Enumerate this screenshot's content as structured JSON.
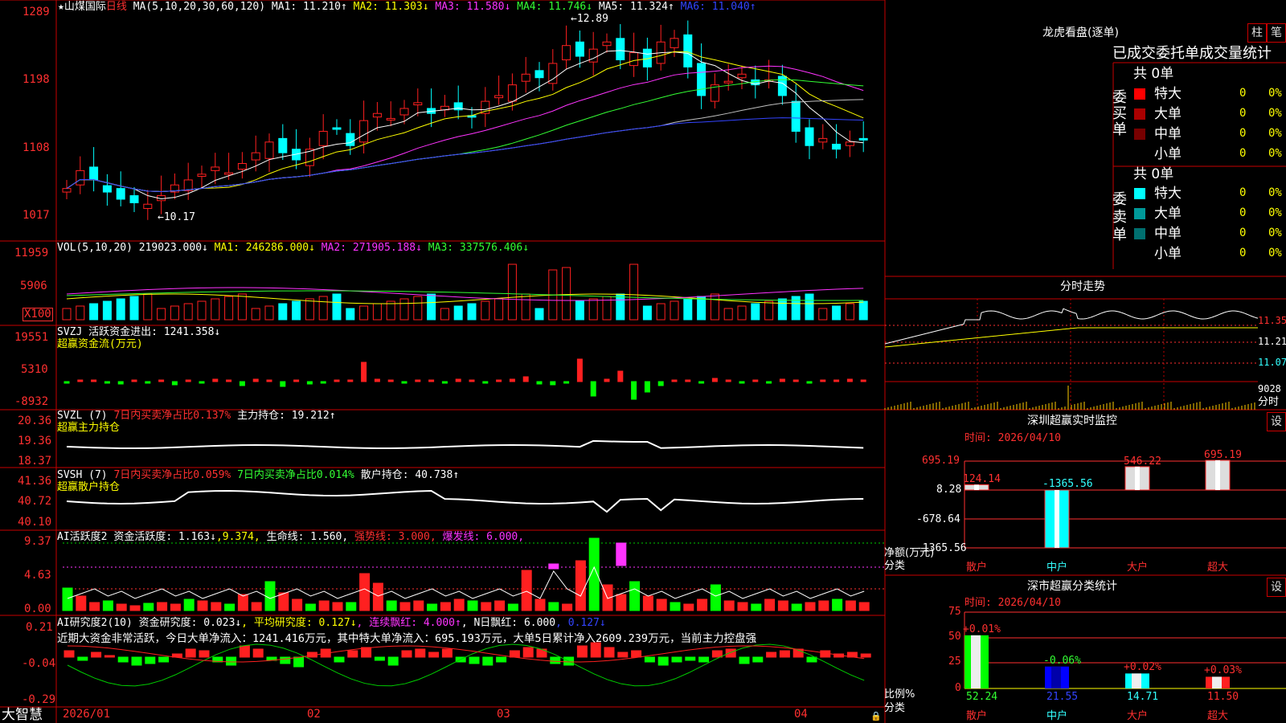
{
  "stock": {
    "name": "山煤国际",
    "period": "日线",
    "ma_header": "MA(5,10,20,30,60,120)",
    "ma1": "MA1: 11.210↑",
    "ma2": "MA2: 11.303↓",
    "ma3": "MA3: 11.580↓",
    "ma4": "MA4: 11.746↓",
    "ma5": "MA5: 11.324↑",
    "ma6": "MA6: 11.040↑",
    "high_label": "12.89",
    "low_label": "10.17",
    "y_ticks": [
      "1289",
      "1198",
      "1108",
      "1017"
    ]
  },
  "vol": {
    "header": "VOL(5,10,20)",
    "value": "219023.000↓",
    "ma1": "MA1: 246286.000↓",
    "ma2": "MA2: 271905.188↓",
    "ma3": "MA3: 337576.406↓",
    "y_ticks": [
      "11959",
      "5906"
    ],
    "unit": "X100"
  },
  "svzj": {
    "header": "SVZJ  活跃资金进出: 1241.358↓",
    "subtitle": "超赢资金流(万元)",
    "y_ticks": [
      "19551",
      "5310",
      "-8932"
    ]
  },
  "svzl": {
    "header": "SVZL (7)",
    "ratio": "7日内买卖净占比0.137%",
    "hold": "主力持仓: 19.212↑",
    "subtitle": "超赢主力持仓",
    "y_ticks": [
      "20.36",
      "19.36",
      "18.37"
    ]
  },
  "svsh": {
    "header": "SVSH (7)",
    "ratio1": "7日内买卖净占比0.059%",
    "ratio2": "7日内买卖净占比0.014%",
    "hold": "散户持仓: 40.738↑",
    "subtitle": "超赢散户持仓",
    "y_ticks": [
      "41.36",
      "40.72",
      "40.10"
    ]
  },
  "ai_active": {
    "header": "AI活跃度2",
    "value": "资金活跃度: 1.163↓",
    "v2": "9.374",
    "life": "生命线: 1.560",
    "strong": "强势线: 3.000",
    "burst": "爆发线: 6.000",
    "y_ticks": [
      "9.37",
      "4.63",
      "0.00"
    ]
  },
  "ai_research": {
    "header": "AI研究度2(10)",
    "value": "资金研究度: 0.023↓",
    "avg": "平均研究度: 0.127↓",
    "cont": "连续飘红: 4.000↑",
    "nday": "N日飘红: 6.000",
    "v5": "0.127↓",
    "summary": "近期大资金非常活跃，今日大单净流入：1241.416万元，其中特大单净流入：695.193万元，大单5日累计净入2609.239万元，当前主力控盘强",
    "y_ticks": [
      "0.21",
      "-0.04",
      "-0.29"
    ]
  },
  "xaxis": {
    "labels": [
      "2026/01",
      "02",
      "03",
      "04"
    ],
    "brand": "大智慧"
  },
  "dragon": {
    "title": "龙虎看盘(逐单)",
    "btn_zhu": "柱",
    "btn_bi": "笔",
    "subtitle": "已成交委托单成交量统计",
    "buy_label": "委买单",
    "sell_label": "委卖单",
    "buy_total": "共 0单",
    "sell_total": "共 0单",
    "buy_rows": [
      {
        "name": "特大",
        "count": "0",
        "pct": "0%",
        "color": "#ff0000"
      },
      {
        "name": "大单",
        "count": "0",
        "pct": "0%",
        "color": "#aa0000"
      },
      {
        "name": "中单",
        "count": "0",
        "pct": "0%",
        "color": "#770000"
      },
      {
        "name": "小单",
        "count": "0",
        "pct": "0%",
        "color": ""
      }
    ],
    "sell_rows": [
      {
        "name": "特大",
        "count": "0",
        "pct": "0%",
        "color": "#00ffff"
      },
      {
        "name": "大单",
        "count": "0",
        "pct": "0%",
        "color": "#009999"
      },
      {
        "name": "中单",
        "count": "0",
        "pct": "0%",
        "color": "#006f6f"
      },
      {
        "name": "小单",
        "count": "0",
        "pct": "0%",
        "color": ""
      }
    ]
  },
  "intraday": {
    "title": "分时走势",
    "prices": [
      "11.35",
      "11.21",
      "11.07"
    ],
    "vol_label": "9028",
    "vol_unit": "分时"
  },
  "sz_monitor": {
    "title": "深圳超赢实时监控",
    "btn": "设",
    "time": "时间: 2026/04/10",
    "y_ticks": [
      "695.19",
      "8.28",
      "-678.64",
      "-1365.56"
    ],
    "y_label": "净额(万元)",
    "x_label": "分类",
    "bars": [
      {
        "name": "散户",
        "value": 124.14,
        "label": "124.14"
      },
      {
        "name": "中户",
        "value": -1365.56,
        "label": "-1365.56"
      },
      {
        "name": "大户",
        "value": 546.22,
        "label": "546.22"
      },
      {
        "name": "超大",
        "value": 695.19,
        "label": "695.19"
      }
    ]
  },
  "sz_class": {
    "title": "深市超赢分类统计",
    "btn": "设",
    "time": "时间: 2026/04/10",
    "y_ticks": [
      "75",
      "50",
      "25",
      "0"
    ],
    "y_label": "比例%",
    "x_label": "分类",
    "bars": [
      {
        "name": "散户",
        "value": 52.24,
        "label": "52.24",
        "delta": "+0.01%"
      },
      {
        "name": "中户",
        "value": 21.55,
        "label": "21.55",
        "delta": "-0.06%"
      },
      {
        "name": "大户",
        "value": 14.71,
        "label": "14.71",
        "delta": "+0.02%"
      },
      {
        "name": "超大",
        "value": 11.5,
        "label": "11.50",
        "delta": "+0.03%"
      }
    ]
  }
}
